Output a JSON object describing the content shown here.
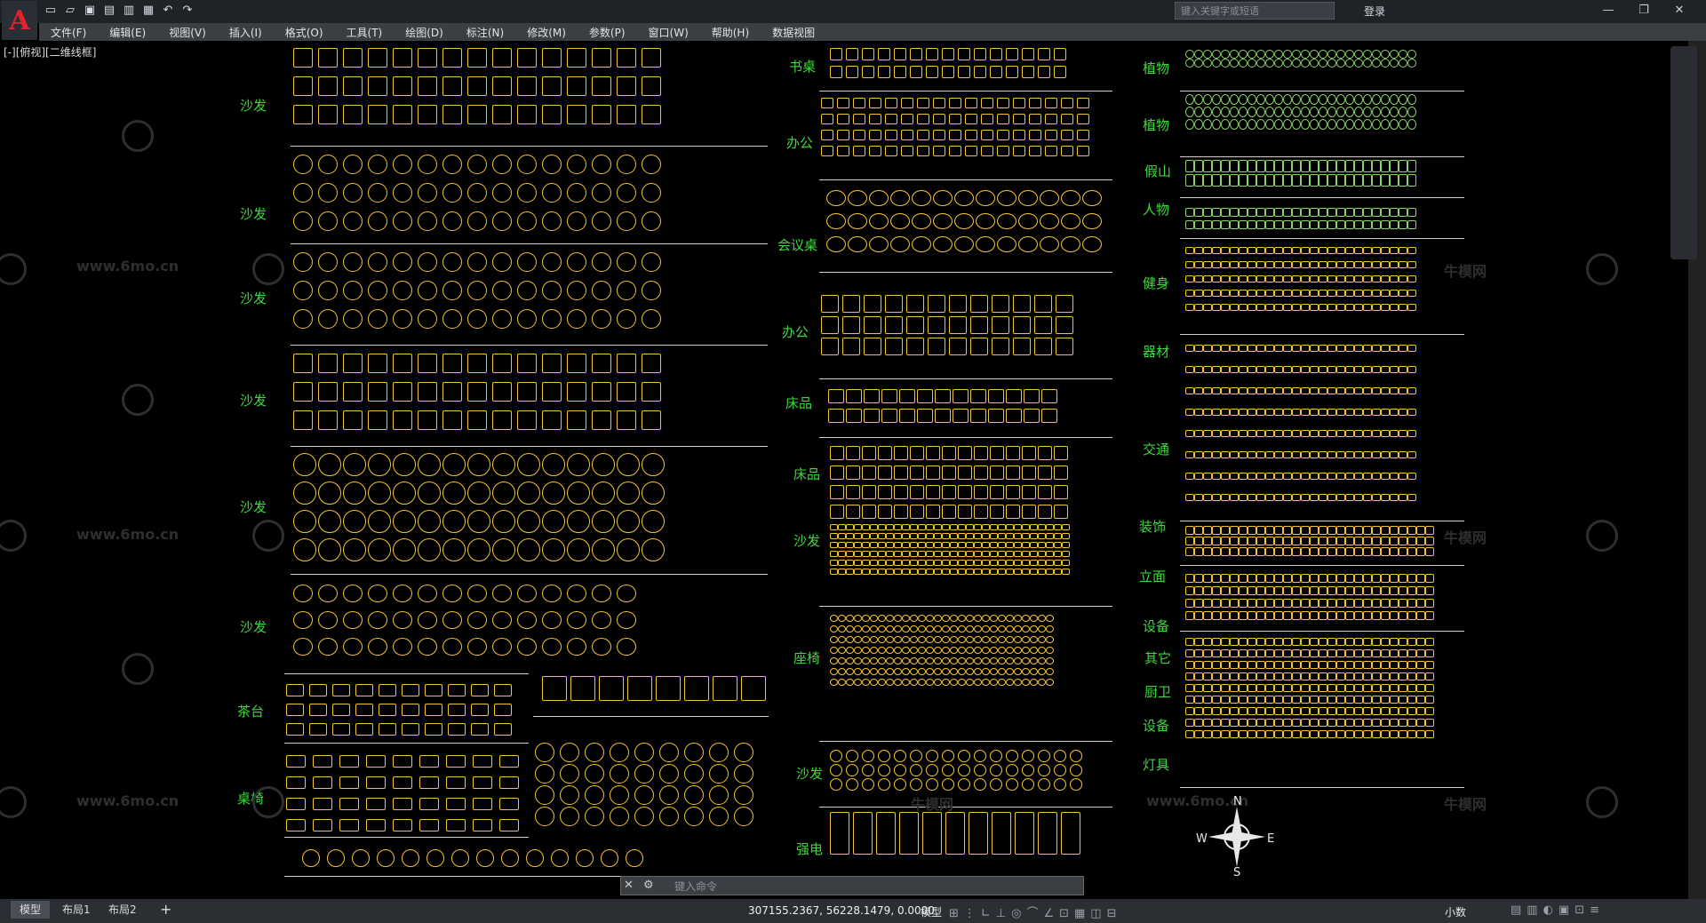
{
  "app": {
    "title": "",
    "search_placeholder": "键入关键字或短语",
    "login": "登录"
  },
  "menu": [
    "文件(F)",
    "编辑(E)",
    "视图(V)",
    "插入(I)",
    "格式(O)",
    "工具(T)",
    "绘图(D)",
    "标注(N)",
    "修改(M)",
    "参数(P)",
    "窗口(W)",
    "帮助(H)",
    "数据视图"
  ],
  "viewport_label": "[-][俯视][二维线框]",
  "labels_left": [
    "沙发",
    "沙发",
    "沙发",
    "沙发",
    "沙发",
    "沙发",
    "茶台",
    "桌椅"
  ],
  "labels_mid": [
    "书桌",
    "办公",
    "会议桌",
    "办公",
    "床品",
    "床品",
    "沙发",
    "座椅",
    "沙发",
    "强电"
  ],
  "labels_right": [
    "植物",
    "植物",
    "假山",
    "人物",
    "健身",
    "器材",
    "交通",
    "装饰",
    "立面",
    "设备",
    "其它",
    "厨卫",
    "设备",
    "灯具"
  ],
  "watermark": {
    "site": "www.6mo.cn",
    "brand": "牛模网"
  },
  "compass": {
    "n": "N",
    "s": "S",
    "e": "E",
    "w": "W"
  },
  "command_placeholder": "键入命令",
  "tabs": [
    "模型",
    "布局1",
    "布局2"
  ],
  "coordinates": "307155.2367, 56228.1479, 0.0000",
  "status": {
    "model": "模型",
    "units": "小数"
  },
  "colors": {
    "symbols": "#f4c430",
    "labels": "#3ed83e",
    "plants": "#8ed36a",
    "canvas": "#000000"
  }
}
